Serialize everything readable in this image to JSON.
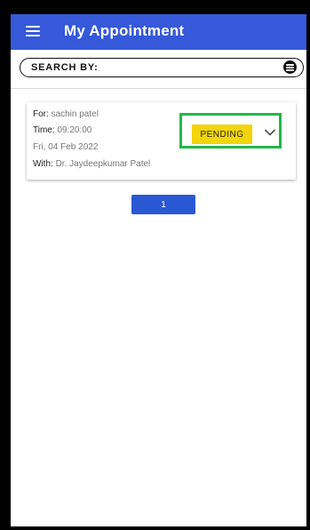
{
  "header": {
    "title": "My Appointment",
    "menu_icon": "hamburger-menu-icon"
  },
  "search": {
    "label": "SEARCH BY:",
    "filter_icon": "filter-icon"
  },
  "appointment": {
    "for_label": "For:",
    "for_value": "sachin patel",
    "time_label": "Time:",
    "time_value": "09:20:00",
    "date": "Fri, 04 Feb 2022",
    "with_label": "With:",
    "with_value": "Dr. Jaydeepkumar Patel",
    "status": "PENDING",
    "expand_icon": "chevron-down-icon"
  },
  "pagination": {
    "current_page": "1"
  },
  "colors": {
    "appbar": "#3559d8",
    "status_badge": "#f2d40a",
    "highlight_border": "#22b84a",
    "page_button": "#2a58d3"
  }
}
